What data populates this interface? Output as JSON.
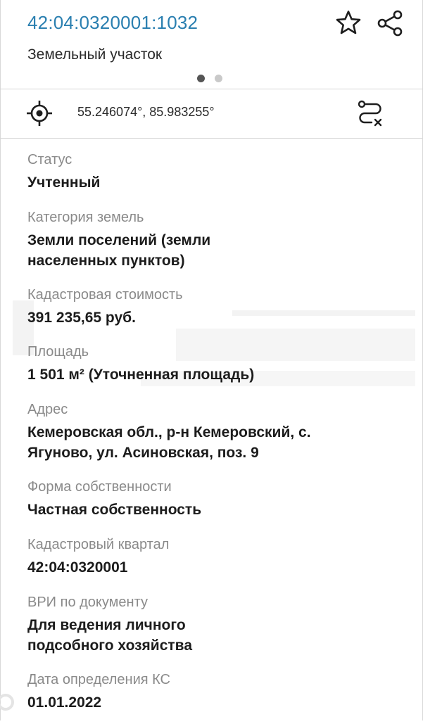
{
  "header": {
    "cadastral_number": "42:04:0320001:1032",
    "object_type": "Земельный участок",
    "pager": {
      "count": 2,
      "active": 1
    }
  },
  "coords": {
    "text": "55.246074°, 85.983255°"
  },
  "icons": {
    "favorite": "star-icon",
    "share": "share-icon",
    "locate": "crosshair-icon",
    "route": "route-clear-icon"
  },
  "colors": {
    "accent": "#2a7fb0",
    "label": "#8a8a8a",
    "value": "#1c1c1c"
  },
  "fields": [
    {
      "label": "Статус",
      "value": "Учтенный"
    },
    {
      "label": "Категория земель",
      "value_lines": [
        "Земли поселений (земли",
        "населенных пунктов)"
      ]
    },
    {
      "label": "Кадастровая стоимость",
      "value": "391 235,65 руб."
    },
    {
      "label": "Площадь",
      "value": "1 501 м² (Уточненная площадь)"
    },
    {
      "label": "Адрес",
      "value_lines": [
        "Кемеровская обл., р-н Кемеровский, с.",
        "Ягуново, ул. Асиновская, поз. 9"
      ]
    },
    {
      "label": "Форма собственности",
      "value": "Частная собственность"
    },
    {
      "label": "Кадастровый квартал",
      "value": "42:04:0320001"
    },
    {
      "label": "ВРИ по документу",
      "value_lines": [
        "Для ведения личного",
        "подсобного хозяйства"
      ]
    },
    {
      "label": "Дата определения КС",
      "value": "01.01.2022"
    }
  ]
}
